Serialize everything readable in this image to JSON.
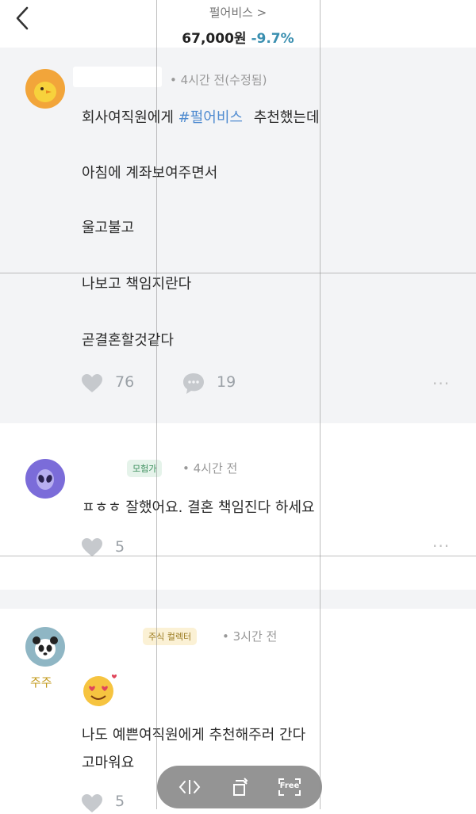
{
  "header": {
    "stock_name": "펄어비스 >",
    "price": "67,000원",
    "change": "-9.7%"
  },
  "post": {
    "meta": "• 4시간 전(수정됨)",
    "line1_prefix": "회사여직원에게",
    "hashtag": "#펄어비스",
    "line1_suffix": "추천했는데",
    "line2": "아침에 계좌보여주면서",
    "line3": "울고불고",
    "line4": "나보고 책임지란다",
    "line5": "곧결혼할것같다",
    "likes": "76",
    "comments": "19",
    "more": "···"
  },
  "comment1": {
    "badge": "모험가",
    "meta": "• 4시간 전",
    "text": "ㅍㅎㅎ 잘했어요. 결혼 책임진다 하세요",
    "likes": "5",
    "more": "···"
  },
  "comment2": {
    "badge": "주식 컬렉터",
    "meta": "• 3시간 전",
    "avatar_label": "주주",
    "line1": "나도 예쁜여직원에게 추천해주러 간다",
    "line2": "고마워요",
    "likes": "5"
  },
  "toolbar": {
    "free_label": "Free"
  },
  "colors": {
    "accent_blue": "#3a8fb0",
    "hashtag": "#4f8bd0",
    "post_bg": "#f3f4f6",
    "badge_green": "#e5f3ea",
    "badge_yellow": "#fbf1d5"
  }
}
